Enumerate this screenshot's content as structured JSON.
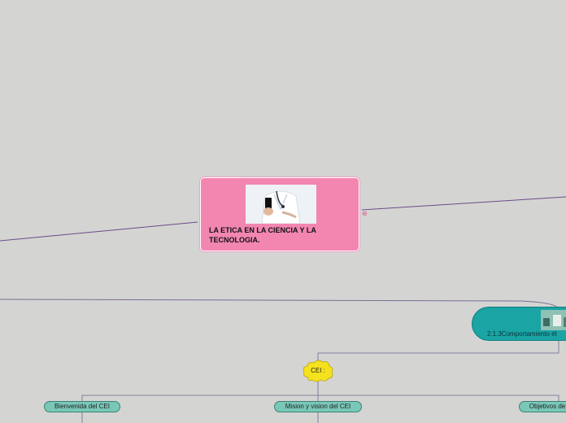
{
  "central_topic": {
    "title": "LA ETICA EN LA CIENCIA Y LA TECNOLOGIA.",
    "image_icon": "doctor-with-phone-image"
  },
  "collapse_indicator": "⊖",
  "subtopic": {
    "label": "2.1.3Comportamiento ét",
    "image_icon": "classroom-thumbnail-image"
  },
  "cloud_node": {
    "label": "CEI :"
  },
  "children": [
    {
      "label": "Bienvenida del CEI"
    },
    {
      "label": "Mision y vision del CEI"
    },
    {
      "label": "Objetivos de"
    }
  ],
  "colors": {
    "background": "#d4d5d2",
    "central_fill": "#f286b0",
    "subtopic_fill": "#1aa4a4",
    "cloud_fill": "#f5e21e",
    "pill_fill": "#79c8b7",
    "connector": "#6b4a8a"
  }
}
